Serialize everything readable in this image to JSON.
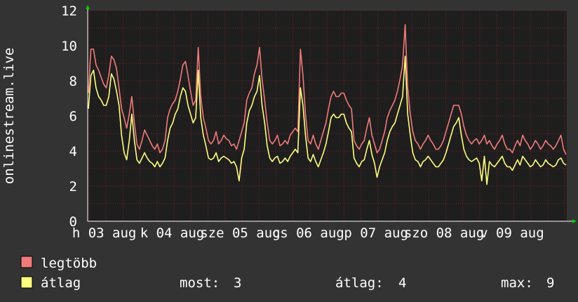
{
  "chart_data": {
    "type": "line",
    "ylabel": "onlinestream.live",
    "ylim": [
      0,
      12
    ],
    "yticks": [
      0,
      2,
      4,
      6,
      8,
      10,
      12
    ],
    "grid": true,
    "colors": {
      "background": "#333333",
      "plot_bg": "#1e1e1e",
      "grid": "#7a2020",
      "frame": "#ffffff",
      "arrow": "#00cc00",
      "series_max": "#f07a7a",
      "series_avg": "#ffff80"
    },
    "x_tick_labels": [
      "h 03 aug",
      "k 04 aug",
      "sze 05 aug",
      "cs 06 aug",
      "p 07 aug",
      "szo 08 aug",
      "v 09 aug"
    ],
    "series": [
      {
        "name": "legtöbb",
        "color": "#f07a7a",
        "values": [
          7.3,
          9.8,
          9.8,
          8.9,
          8.6,
          8.2,
          7.8,
          7.6,
          8.3,
          9.4,
          9.2,
          8.7,
          7.6,
          6.4,
          5.9,
          5.3,
          6.1,
          7.1,
          5.6,
          4.4,
          4.1,
          4.6,
          5.2,
          4.9,
          4.6,
          4.3,
          4.1,
          4.4,
          3.9,
          4.1,
          4.6,
          5.9,
          6.4,
          6.7,
          6.9,
          7.4,
          8.1,
          8.9,
          9.1,
          8.3,
          7.4,
          6.6,
          6.9,
          9.9,
          7.1,
          5.9,
          5.3,
          4.6,
          4.4,
          4.6,
          5.1,
          4.4,
          4.6,
          4.9,
          4.7,
          4.6,
          4.3,
          4.4,
          4.1,
          4.6,
          5.1,
          5.6,
          6.9,
          7.3,
          7.6,
          8.4,
          8.9,
          9.9,
          8.1,
          6.9,
          5.6,
          4.6,
          4.4,
          4.6,
          4.9,
          4.3,
          4.4,
          4.6,
          4.4,
          4.9,
          5.1,
          5.3,
          5.1,
          9.8,
          8.3,
          6.1,
          4.6,
          4.4,
          4.9,
          4.4,
          4.1,
          4.6,
          5.1,
          5.6,
          6.4,
          7.1,
          7.4,
          7.1,
          7.1,
          7.3,
          7.3,
          6.9,
          6.6,
          6.4,
          4.6,
          4.3,
          4.1,
          4.4,
          4.6,
          5.3,
          5.9,
          4.9,
          4.4,
          3.9,
          4.1,
          4.6,
          5.1,
          5.9,
          6.3,
          6.6,
          6.9,
          7.4,
          8.1,
          8.9,
          11.2,
          7.6,
          6.1,
          5.1,
          4.6,
          4.4,
          4.1,
          4.4,
          4.6,
          4.9,
          4.6,
          4.4,
          4.1,
          4.1,
          4.3,
          4.6,
          5.1,
          5.6,
          6.1,
          6.6,
          6.6,
          6.6,
          6.1,
          5.4,
          4.9,
          4.6,
          4.4,
          4.6,
          4.7,
          4.4,
          4.6,
          4.9,
          4.4,
          4.6,
          4.3,
          4.1,
          4.4,
          4.6,
          4.9,
          4.4,
          4.1,
          4.1,
          3.9,
          4.3,
          4.6,
          4.3,
          4.9,
          4.6,
          4.4,
          4.1,
          4.3,
          4.6,
          4.4,
          4.1,
          4.3,
          4.6,
          4.4,
          4.3,
          4.1,
          4.3,
          4.6,
          4.9,
          4.1,
          3.8
        ]
      },
      {
        "name": "átlag",
        "color": "#ffff80",
        "values": [
          6.4,
          8.3,
          8.6,
          7.6,
          7.1,
          6.9,
          6.6,
          6.6,
          7.1,
          8.4,
          8.1,
          7.4,
          6.6,
          4.9,
          3.9,
          3.5,
          4.6,
          6.1,
          4.6,
          3.5,
          3.3,
          3.6,
          3.9,
          3.6,
          3.4,
          3.3,
          3.1,
          3.4,
          3.1,
          3.3,
          3.6,
          4.6,
          5.3,
          5.6,
          6.1,
          6.4,
          7.1,
          7.6,
          7.4,
          6.6,
          6.1,
          5.6,
          5.9,
          8.6,
          5.9,
          4.9,
          4.3,
          3.6,
          3.5,
          3.6,
          3.9,
          3.4,
          3.6,
          3.7,
          3.6,
          3.5,
          3.3,
          3.4,
          3.1,
          2.3,
          3.6,
          4.1,
          5.6,
          6.3,
          6.6,
          7.1,
          7.4,
          8.3,
          6.6,
          5.6,
          4.3,
          3.6,
          3.4,
          3.6,
          3.7,
          3.3,
          3.4,
          3.6,
          3.4,
          3.7,
          3.9,
          4.1,
          3.9,
          7.6,
          6.6,
          4.9,
          3.6,
          3.4,
          3.8,
          3.4,
          3.1,
          3.5,
          3.9,
          4.4,
          5.1,
          5.9,
          6.1,
          5.9,
          5.9,
          6.1,
          6.1,
          5.6,
          5.3,
          5.1,
          3.6,
          3.3,
          3.1,
          3.4,
          3.5,
          4.1,
          4.6,
          3.8,
          3.3,
          2.5,
          3.1,
          3.5,
          3.9,
          4.6,
          5.1,
          5.4,
          5.6,
          6.1,
          6.6,
          7.1,
          9.4,
          6.1,
          4.9,
          3.9,
          3.5,
          3.4,
          3.1,
          3.4,
          3.5,
          3.7,
          3.5,
          3.3,
          3.1,
          3.1,
          3.3,
          3.5,
          3.9,
          4.4,
          4.9,
          5.4,
          5.6,
          5.9,
          4.9,
          4.1,
          3.7,
          3.5,
          3.4,
          3.5,
          3.6,
          3.3,
          2.3,
          3.7,
          2.1,
          3.4,
          3.2,
          3.1,
          3.3,
          3.5,
          3.7,
          3.3,
          3.1,
          3.1,
          2.9,
          3.2,
          3.5,
          3.2,
          3.7,
          3.5,
          3.3,
          3.1,
          3.2,
          3.5,
          3.3,
          3.1,
          3.2,
          3.5,
          3.3,
          3.2,
          3.1,
          3.2,
          3.5,
          3.6,
          3.3,
          3.2
        ]
      }
    ]
  },
  "legend": {
    "max_label": "legtöbb",
    "avg_label": "átlag",
    "stats": [
      {
        "label": "most:",
        "value": "3"
      },
      {
        "label": "átlag:",
        "value": "4"
      },
      {
        "label": "max:",
        "value": "9"
      }
    ]
  }
}
